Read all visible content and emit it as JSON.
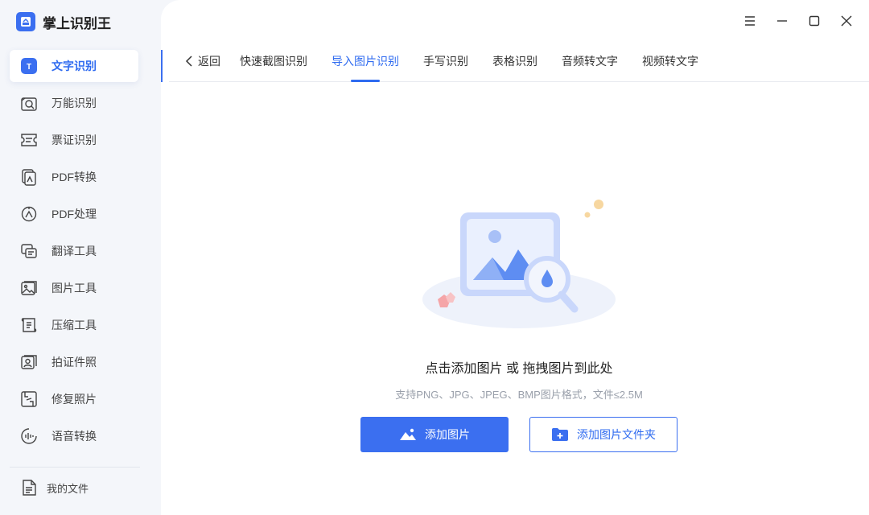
{
  "app": {
    "title": "掌上识别王"
  },
  "sidebar": {
    "items": [
      {
        "label": "文字识别",
        "icon": "text-ocr-icon",
        "active": true
      },
      {
        "label": "万能识别",
        "icon": "universal-scan-icon"
      },
      {
        "label": "票证识别",
        "icon": "ticket-icon"
      },
      {
        "label": "PDF转换",
        "icon": "pdf-convert-icon"
      },
      {
        "label": "PDF处理",
        "icon": "pdf-process-icon"
      },
      {
        "label": "翻译工具",
        "icon": "translate-icon"
      },
      {
        "label": "图片工具",
        "icon": "image-tool-icon"
      },
      {
        "label": "压缩工具",
        "icon": "compress-icon"
      },
      {
        "label": "拍证件照",
        "icon": "id-photo-icon"
      },
      {
        "label": "修复照片",
        "icon": "repair-photo-icon"
      },
      {
        "label": "语音转换",
        "icon": "voice-icon"
      }
    ],
    "my_files": "我的文件"
  },
  "tabs": {
    "back": "返回",
    "items": [
      {
        "label": "快速截图识别"
      },
      {
        "label": "导入图片识别",
        "active": true
      },
      {
        "label": "手写识别"
      },
      {
        "label": "表格识别"
      },
      {
        "label": "音频转文字"
      },
      {
        "label": "视频转文字"
      }
    ]
  },
  "drop": {
    "title": "点击添加图片 或 拖拽图片到此处",
    "subtitle": "支持PNG、JPG、JPEG、BMP图片格式，文件≤2.5M",
    "add_image": "添加图片",
    "add_folder": "添加图片文件夹"
  },
  "colors": {
    "accent": "#3b6ff0",
    "sidebar_bg": "#f4f6fa"
  }
}
